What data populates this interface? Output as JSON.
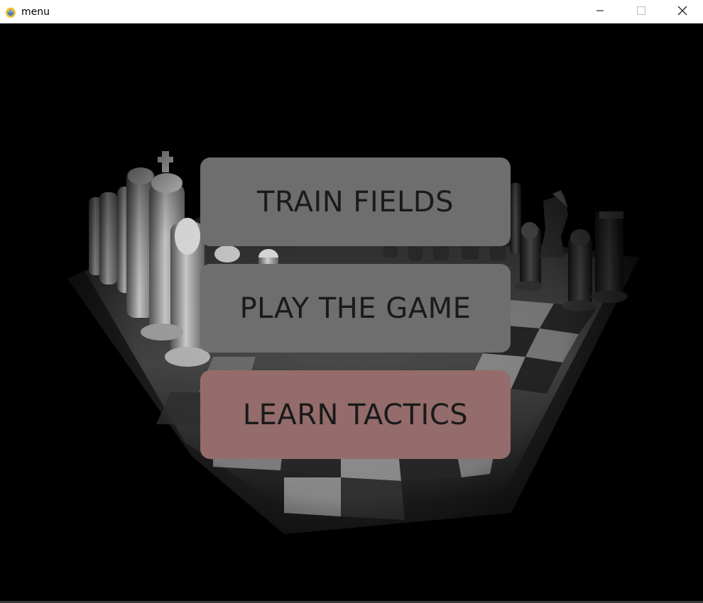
{
  "window": {
    "title": "menu",
    "icon": "pygame-snake-icon",
    "controls": [
      "minimize-icon",
      "maximize-icon",
      "close-icon"
    ]
  },
  "background": {
    "description_icon": "chessboard-background-image"
  },
  "menu": {
    "train_label": "TRAIN FIELDS",
    "play_label": "PLAY THE GAME",
    "learn_label": "LEARN TACTICS",
    "colors": {
      "default": "#6e6e6e",
      "hovered": "#946c6c",
      "text": "#1a1a1a"
    }
  }
}
